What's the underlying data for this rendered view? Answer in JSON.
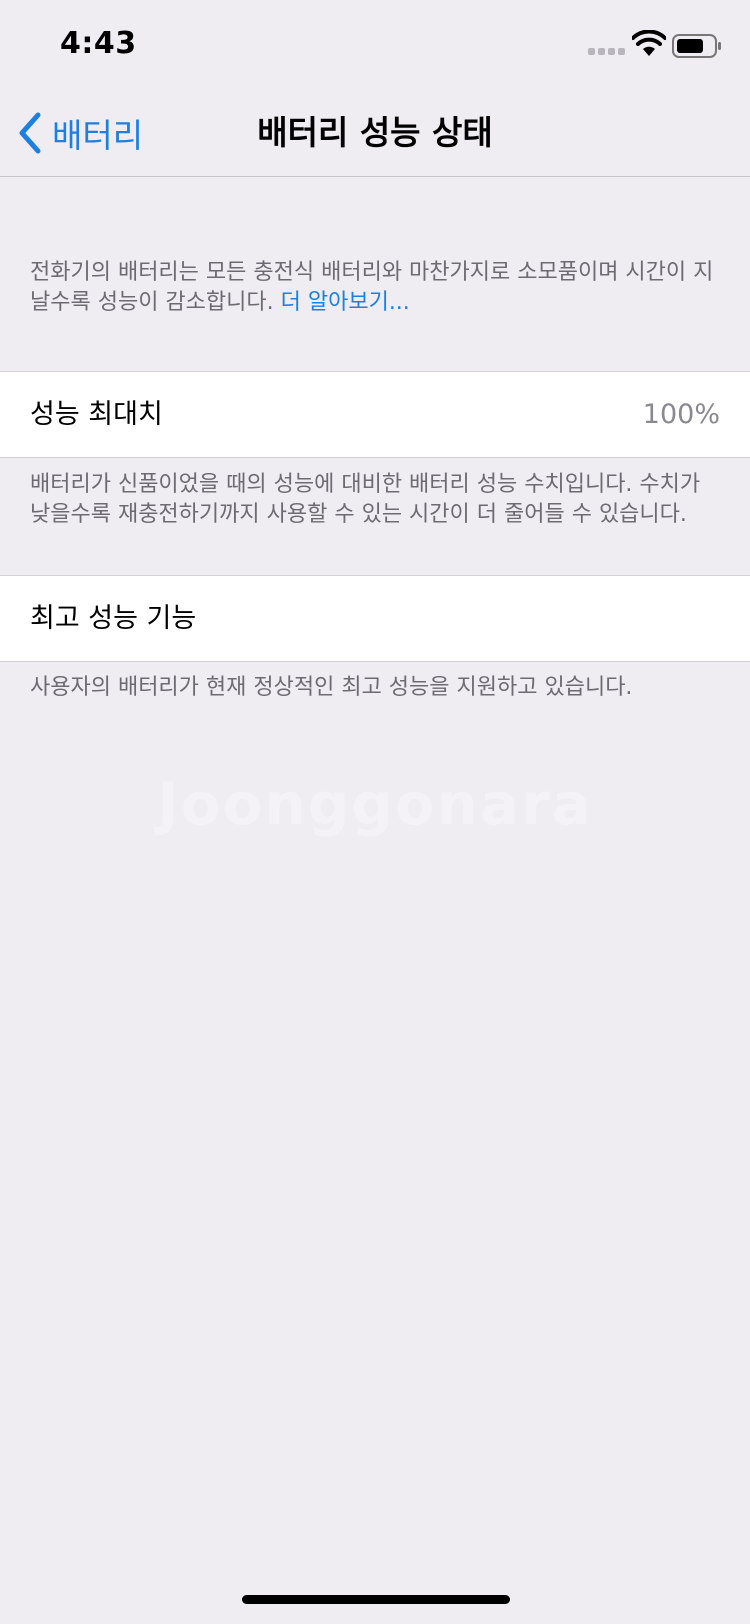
{
  "status_bar": {
    "time": "4:43",
    "icons": [
      "cellular-signal-icon",
      "wifi-icon",
      "battery-icon"
    ]
  },
  "nav": {
    "back_label": "배터리",
    "title": "배터리 성능 상태"
  },
  "intro": {
    "text": "전화기의 배터리는 모든 충전식 배터리와 마찬가지로 소모품이며 시간이 지날수록 성능이 감소합니다.",
    "link": "더 알아보기..."
  },
  "max_capacity": {
    "label": "성능 최대치",
    "value": "100%",
    "footnote": "배터리가 신품이었을 때의 성능에 대비한 배터리 성능 수치입니다. 수치가 낮을수록 재충전하기까지 사용할 수 있는 시간이 더 줄어들 수 있습니다."
  },
  "peak_performance": {
    "label": "최고 성능 기능",
    "footnote": "사용자의 배터리가 현재 정상적인 최고 성능을 지원하고 있습니다."
  },
  "watermark": "Joonggonara",
  "colors": {
    "background": "#efecf2",
    "accent": "#1d7fe0",
    "secondary_text": "#6d6b72"
  }
}
